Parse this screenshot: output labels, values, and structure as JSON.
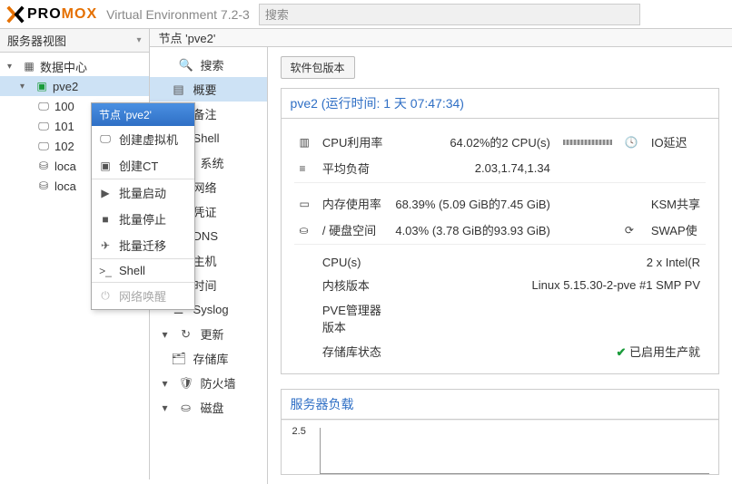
{
  "header": {
    "brand_prefix": "PRO",
    "brand_suffix": "MOX",
    "env_text": "Virtual Environment 7.2-3",
    "search_placeholder": "搜索"
  },
  "sidebar": {
    "view_label": "服务器视图",
    "tree": {
      "datacenter": "数据中心",
      "node": "pve2",
      "items": [
        {
          "id": "100",
          "label": "100"
        },
        {
          "id": "101",
          "label": "101"
        },
        {
          "id": "102",
          "label": "102"
        },
        {
          "id": "local1",
          "label": "loca"
        },
        {
          "id": "local2",
          "label": "loca"
        }
      ]
    }
  },
  "context_menu": {
    "title": "节点 'pve2'",
    "items": [
      {
        "icon": "monitor-icon",
        "label": "创建虚拟机"
      },
      {
        "icon": "cube-icon",
        "label": "创建CT"
      },
      {
        "sep": true
      },
      {
        "icon": "play-icon",
        "label": "批量启动"
      },
      {
        "icon": "stop-icon",
        "label": "批量停止"
      },
      {
        "icon": "migrate-icon",
        "label": "批量迁移"
      },
      {
        "sep": true
      },
      {
        "icon": "shell-icon",
        "label": "Shell"
      },
      {
        "sep": true
      },
      {
        "icon": "power-icon",
        "label": "网络唤醒",
        "disabled": true
      }
    ]
  },
  "breadcrumb": "节点 'pve2'",
  "nav": [
    {
      "kind": "section",
      "icon": "search-icon",
      "label": "搜索"
    },
    {
      "icon": "summary-icon",
      "label": "概要",
      "active": true
    },
    {
      "icon": "notes-icon",
      "label": "备注"
    },
    {
      "icon": "shell-icon",
      "label": "Shell"
    },
    {
      "kind": "section",
      "icon": "gear-icon",
      "label": "系统"
    },
    {
      "icon": "network-icon",
      "label": "网络"
    },
    {
      "icon": "cert-icon",
      "label": "凭证"
    },
    {
      "icon": "globe-icon",
      "label": "DNS"
    },
    {
      "icon": "host-icon",
      "label": "主机"
    },
    {
      "icon": "clock-icon",
      "label": "时间"
    },
    {
      "icon": "syslog-icon",
      "label": "Syslog"
    },
    {
      "kind": "section",
      "icon": "refresh-icon",
      "label": "更新"
    },
    {
      "icon": "repo-icon",
      "label": "存储库"
    },
    {
      "kind": "section",
      "icon": "shield-icon",
      "label": "防火墙"
    },
    {
      "kind": "section",
      "icon": "disk-icon",
      "label": "磁盘"
    }
  ],
  "detail": {
    "pkg_button": "软件包版本",
    "title_node": "pve2",
    "title_uptime": "(运行时间: 1 天 07:47:34)",
    "stats": {
      "cpu_label": "CPU利用率",
      "cpu_value": "64.02%的2 CPU(s)",
      "io_label": "IO延迟",
      "load_label": "平均负荷",
      "load_value": "2.03,1.74,1.34",
      "mem_label": "内存使用率",
      "mem_value": "68.39% (5.09 GiB的7.45 GiB)",
      "ksm_label": "KSM共享",
      "disk_label": "/ 硬盘空间",
      "disk_value": "4.03% (3.78 GiB的93.93 GiB)",
      "swap_label": "SWAP使"
    },
    "info": {
      "cpus_label": "CPU(s)",
      "cpus_value": "2 x Intel(R",
      "kernel_label": "内核版本",
      "kernel_value": "Linux 5.15.30-2-pve #1 SMP PV",
      "pve_label": "PVE管理器版本",
      "repo_label": "存储库状态",
      "repo_value": "已启用生产就"
    },
    "load_panel_title": "服务器负载",
    "chart_ytick": "2.5"
  }
}
